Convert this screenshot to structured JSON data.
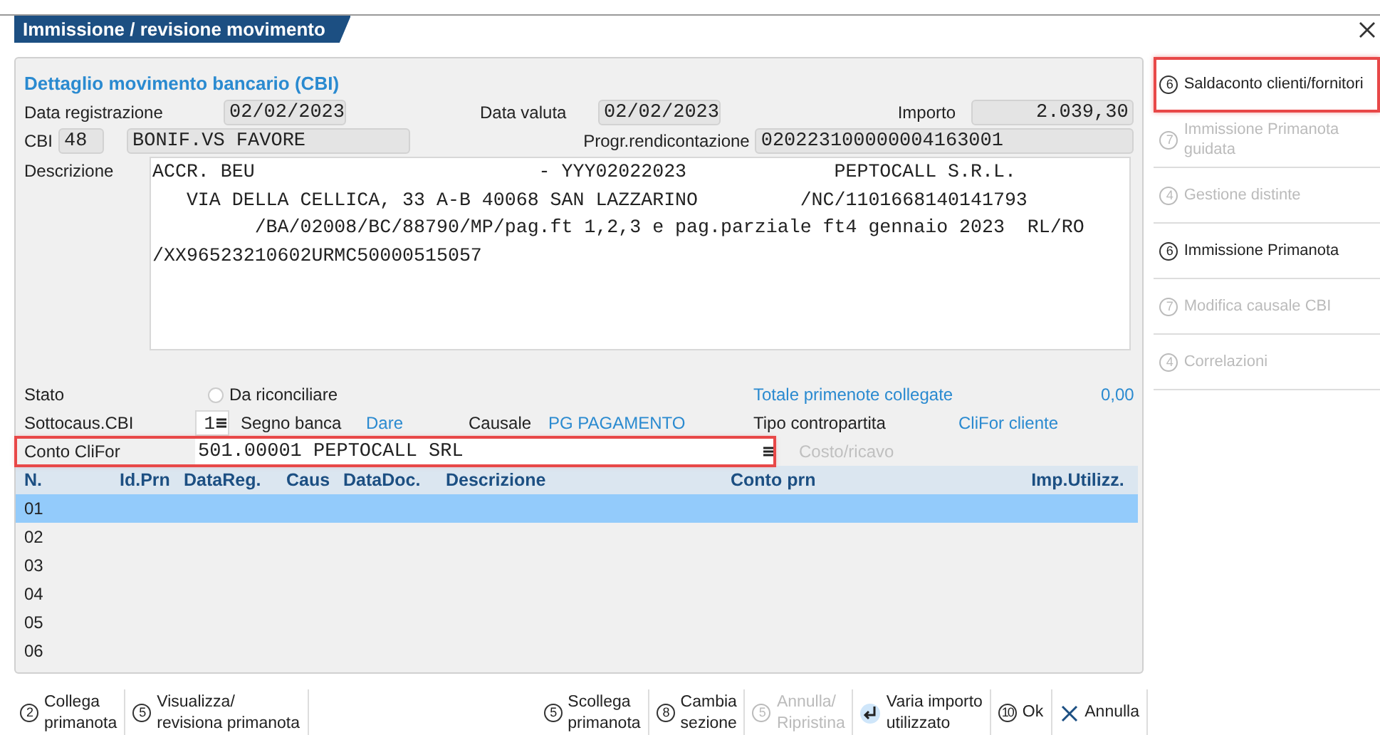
{
  "window": {
    "title": "Immissione / revisione movimento"
  },
  "detail": {
    "heading": "Dettaglio movimento bancario (CBI)",
    "data_registrazione": {
      "label": "Data registrazione",
      "value": "02/02/2023"
    },
    "data_valuta": {
      "label": "Data valuta",
      "value": "02/02/2023"
    },
    "importo": {
      "label": "Importo",
      "value": "2.039,30"
    },
    "cbi": {
      "label": "CBI",
      "code": "48",
      "value": "BONIF.VS FAVORE"
    },
    "progr": {
      "label": "Progr.rendicontazione",
      "value": "020223100000004163001"
    },
    "descrizione": {
      "label": "Descrizione",
      "value": "ACCR. BEU                         - YYY02022023             PEPTOCALL S.R.L.\n   VIA DELLA CELLICA, 33 A-B 40068 SAN LAZZARINO         /NC/1101668140141793\n         /BA/02008/BC/88790/MP/pag.ft 1,2,3 e pag.parziale ft4 gennaio 2023  RL/RO\n/XX96523210602URMC50000515057"
    },
    "stato": {
      "label": "Stato",
      "value": "Da riconciliare",
      "checked": false
    },
    "totale": {
      "label": "Totale primenote collegate",
      "value": "0,00"
    },
    "sottocaus": {
      "label": "Sottocaus.CBI",
      "value": "1"
    },
    "segno": {
      "label": "Segno banca",
      "value": "Dare"
    },
    "causale": {
      "label": "Causale",
      "value": "PG PAGAMENTO"
    },
    "tipo": {
      "label": "Tipo contropartita",
      "value": "CliFor cliente"
    },
    "conto": {
      "label": "Conto CliFor",
      "value": "501.00001 PEPTOCALL SRL",
      "highlighted": true
    },
    "costo": {
      "label": "Costo/ricavo",
      "disabled": true
    }
  },
  "table": {
    "columns": [
      "N.",
      "Id.Prn",
      "DataReg.",
      "Caus",
      "DataDoc.",
      "Descrizione",
      "Conto prn",
      "Imp.Utilizz."
    ],
    "rows": [
      {
        "n": "01",
        "selected": true
      },
      {
        "n": "02",
        "selected": false
      },
      {
        "n": "03",
        "selected": false
      },
      {
        "n": "04",
        "selected": false
      },
      {
        "n": "05",
        "selected": false
      },
      {
        "n": "06",
        "selected": false
      }
    ]
  },
  "sidebar": {
    "items": [
      {
        "key": "6",
        "label": "Saldaconto clienti/fornitori",
        "disabled": false,
        "highlighted": true
      },
      {
        "key": "7",
        "label": "Immissione Primanota\nguidata",
        "disabled": true,
        "highlighted": false
      },
      {
        "key": "4",
        "label": "Gestione distinte",
        "disabled": true,
        "highlighted": false
      },
      {
        "key": "6",
        "label": "Immissione Primanota",
        "disabled": false,
        "highlighted": false
      },
      {
        "key": "7",
        "label": "Modifica causale CBI",
        "disabled": true,
        "highlighted": false
      },
      {
        "key": "4",
        "label": "Correlazioni",
        "disabled": true,
        "highlighted": false
      }
    ]
  },
  "toolbar": {
    "left": [
      {
        "kind": "key",
        "key": "2",
        "label": "Collega\nprimanota",
        "disabled": false
      },
      {
        "kind": "key",
        "key": "5",
        "label": "Visualizza/\nrevisiona primanota",
        "disabled": false
      }
    ],
    "right": [
      {
        "kind": "key",
        "key": "5",
        "label": "Scollega\nprimanota",
        "disabled": false
      },
      {
        "kind": "key",
        "key": "8",
        "label": "Cambia\nsezione",
        "disabled": false
      },
      {
        "kind": "key",
        "key": "5",
        "label": "Annulla/\nRipristina",
        "disabled": true
      },
      {
        "kind": "enter",
        "label": "Varia importo\nutilizzato",
        "disabled": false
      },
      {
        "kind": "key",
        "key": "10",
        "label": "Ok",
        "disabled": false
      },
      {
        "kind": "cancel",
        "label": "Annulla",
        "disabled": false
      }
    ]
  }
}
